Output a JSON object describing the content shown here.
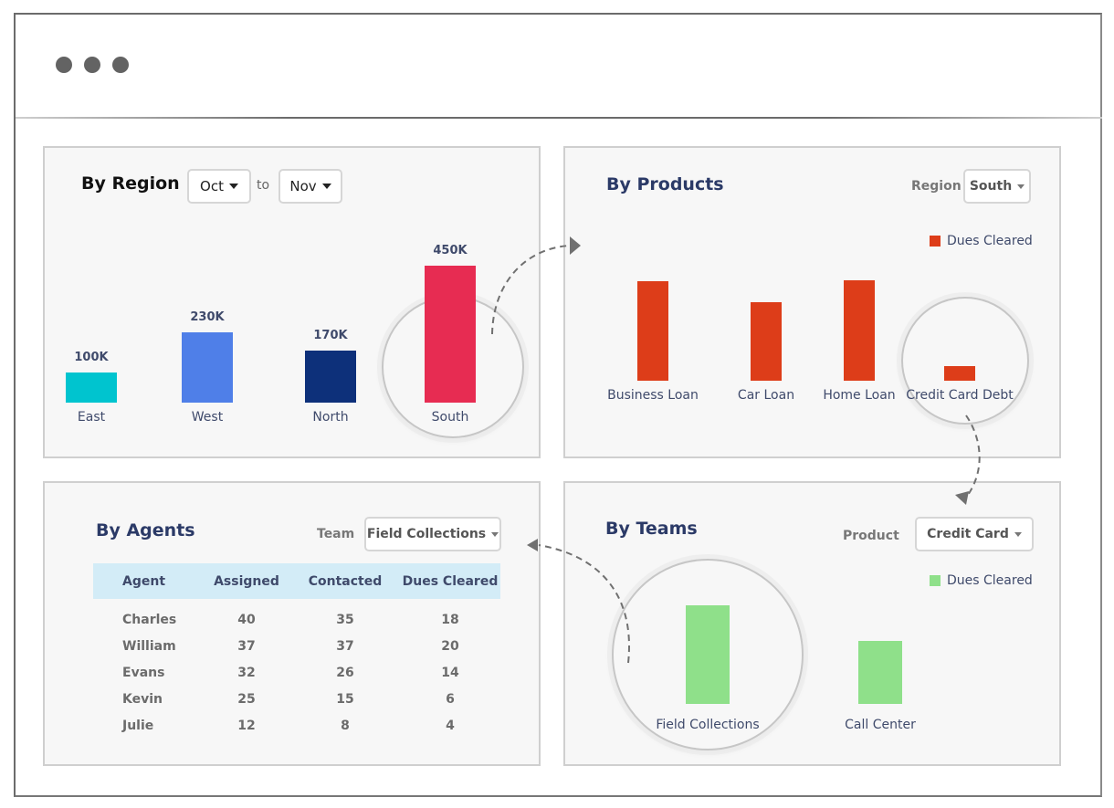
{
  "window": {
    "controls": [
      "dot",
      "dot",
      "dot"
    ],
    "control_color": "#636363"
  },
  "region_panel": {
    "title": "By Region",
    "from_select": {
      "value": "Oct"
    },
    "to_label": "to",
    "to_select": {
      "value": "Nov"
    }
  },
  "products_panel": {
    "title": "By Products",
    "filter_label": "Region",
    "filter_select": {
      "value": "South"
    },
    "legend": "Dues Cleared"
  },
  "agents_panel": {
    "title": "By Agents",
    "filter_label": "Team",
    "filter_select": {
      "value": "Field Collections"
    },
    "columns": [
      "Agent",
      "Assigned",
      "Contacted",
      "Dues Cleared"
    ],
    "rows": [
      [
        "Charles",
        "40",
        "35",
        "18"
      ],
      [
        "William",
        "37",
        "37",
        "20"
      ],
      [
        "Evans",
        "32",
        "26",
        "14"
      ],
      [
        "Kevin",
        "25",
        "15",
        "6"
      ],
      [
        "Julie",
        "12",
        "8",
        "4"
      ]
    ]
  },
  "teams_panel": {
    "title": "By Teams",
    "filter_label": "Product",
    "filter_select": {
      "value": "Credit Card"
    },
    "legend": "Dues Cleared"
  },
  "chart_data": [
    {
      "type": "bar",
      "title": "By Region",
      "categories": [
        "East",
        "West",
        "North",
        "South"
      ],
      "values": [
        100,
        230,
        170,
        450
      ],
      "value_labels": [
        "100K",
        "230K",
        "170K",
        "450K"
      ],
      "colors": [
        "#00c4cf",
        "#4f7fe8",
        "#0d307a",
        "#e72c52"
      ],
      "highlighted": "South",
      "xlabel": "",
      "ylabel": "",
      "ylim": [
        0,
        450
      ],
      "grid": false
    },
    {
      "type": "bar",
      "title": "By Products",
      "categories": [
        "Business Loan",
        "Car Loan",
        "Home Loan",
        "Credit Card Debt"
      ],
      "series": [
        {
          "name": "Dues Cleared",
          "values": [
            108,
            85,
            109,
            16
          ],
          "color": "#dd3d19"
        }
      ],
      "highlighted": "Credit Card Debt",
      "legend": "top-right",
      "xlabel": "",
      "ylabel": "",
      "ylim": [
        0,
        110
      ],
      "grid": false
    },
    {
      "type": "bar",
      "title": "By Teams",
      "categories": [
        "Field Collections",
        "Call Center"
      ],
      "series": [
        {
          "name": "Dues Cleared",
          "values": [
            108,
            69
          ],
          "color": "#8fe08a"
        }
      ],
      "highlighted": "Field Collections",
      "legend": "top-right",
      "xlabel": "",
      "ylabel": "",
      "ylim": [
        0,
        110
      ],
      "grid": false
    }
  ]
}
